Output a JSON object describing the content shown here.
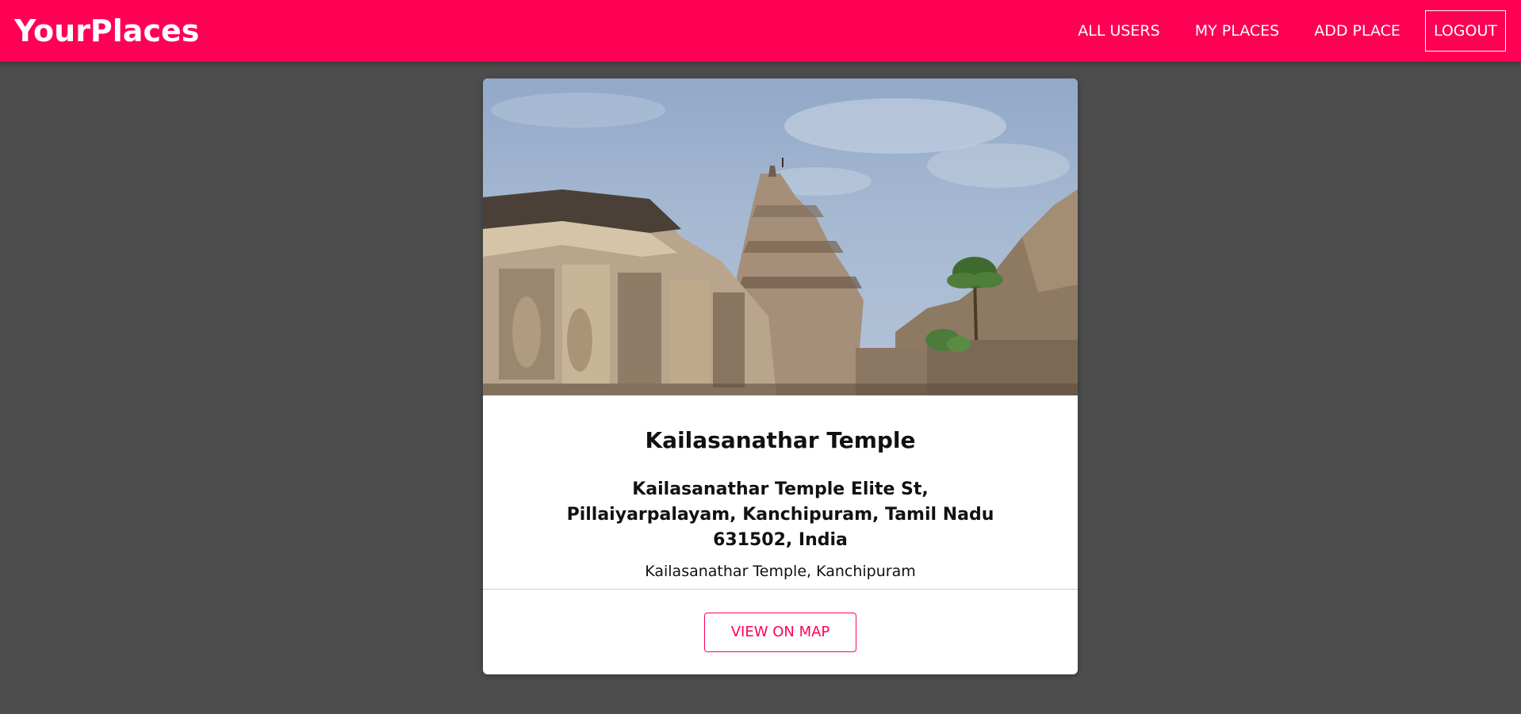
{
  "header": {
    "logo": "YourPlaces",
    "nav": {
      "all_users": "ALL USERS",
      "my_places": "MY PLACES",
      "add_place": "ADD PLACE",
      "logout": "LOGOUT"
    }
  },
  "place": {
    "title": "Kailasanathar Temple",
    "address": "Kailasanathar Temple Elite St, Pillaiyarpalayam, Kanchipuram, Tamil Nadu 631502, India",
    "description": "Kailasanathar Temple, Kanchipuram",
    "image_alt": "Kailasanathar Temple",
    "view_on_map_label": "VIEW ON MAP"
  },
  "colors": {
    "brand": "#ff0055",
    "background": "#4d4d4d",
    "card": "#ffffff"
  }
}
